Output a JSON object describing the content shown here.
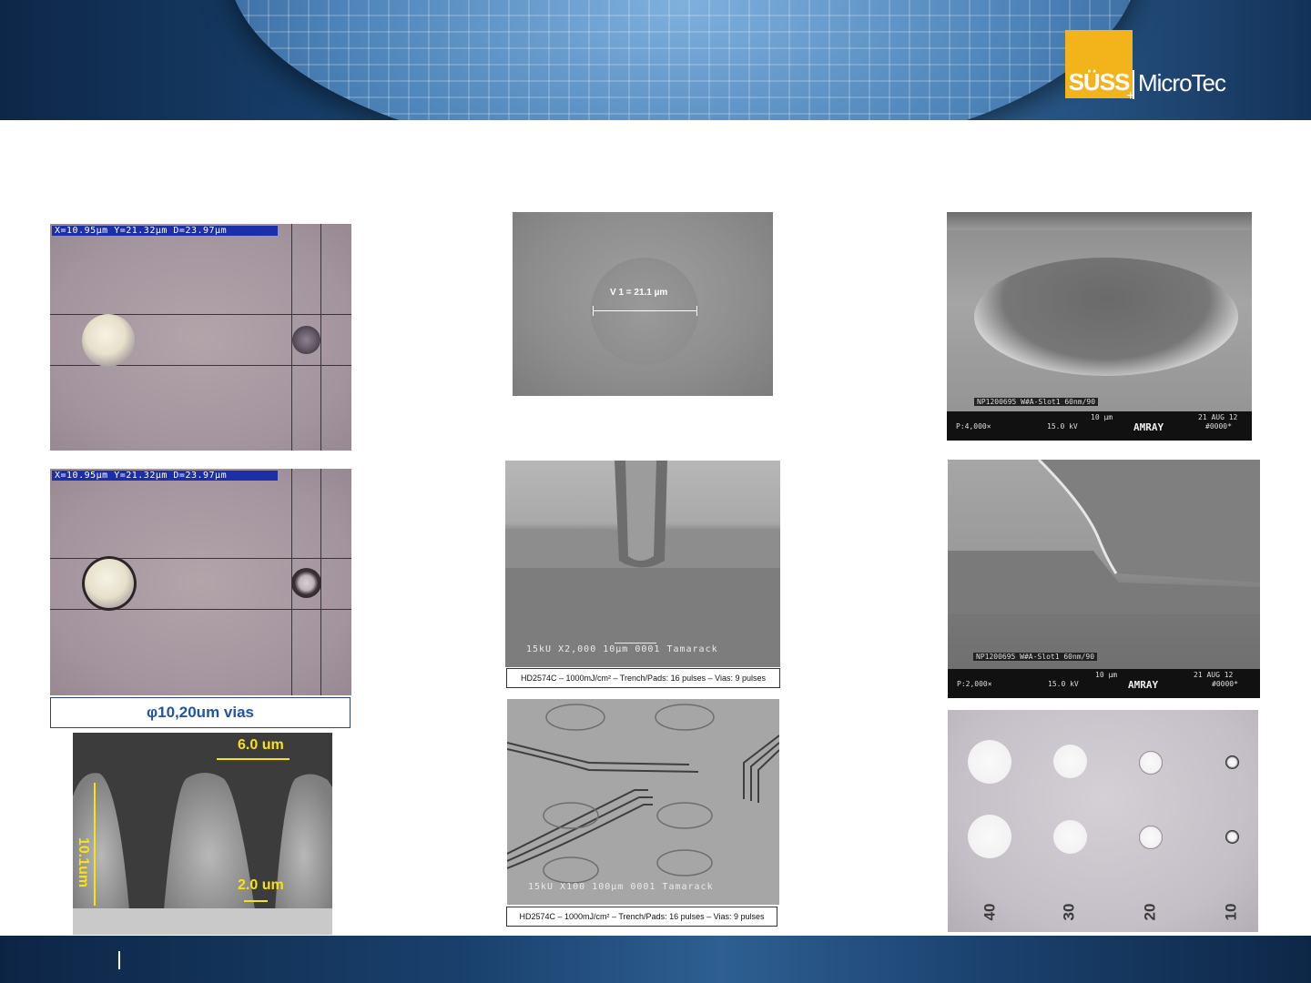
{
  "header": {
    "logo_brand": "SÜSS",
    "logo_name": "MicroTec",
    "logo_plus": "+"
  },
  "panels": {
    "optical_top": {
      "measurement": "X=10.95µm Y=21.32µm D=23.97µm"
    },
    "optical_bottom": {
      "measurement": "X=10.95µm Y=21.32µm D=23.97µm"
    },
    "vias_caption": "φ10,20um vias",
    "profile": {
      "width_top": "6.0 um",
      "height": "10.1um",
      "width_bottom": "2.0 um"
    },
    "sem_via": {
      "measurement": "V 1 = 21.1 µm"
    },
    "sem_trench": {
      "info": "15kU   X2,000   10µm 0001 Tamarack",
      "caption": "HD2574C – 1000mJ/cm² – Trench/Pads: 16 pulses – Vias: 9 pulses"
    },
    "sem_circuit": {
      "info": "15kU    X100  100µm 0001 Tamarack",
      "caption": "HD2574C – 1000mJ/cm² – Trench/Pads: 16 pulses – Vias: 9 pulses"
    },
    "amray_top": {
      "sample": "NP1200695   W#A-Slot1   60nm/90",
      "mag": "P:4,000×",
      "kv": "15.0 kV",
      "scale": "10 µm",
      "brand": "AMRAY",
      "date": "21 AUG 12",
      "id": "#0000*"
    },
    "amray_bottom": {
      "sample": "NP1200695   W#A-Slot1   60nm/90",
      "mag": "P:2,000×",
      "kv": "15.0 kV",
      "scale": "10 µm",
      "brand": "AMRAY",
      "date": "21 AUG 12",
      "id": "#0000*"
    },
    "dot_grid": {
      "labels": [
        "40",
        "30",
        "20",
        "10"
      ]
    }
  },
  "colors": {
    "logo_yellow": "#f2b31b",
    "caption_blue": "#1f54a8",
    "annotation_yellow": "#f6e312"
  }
}
